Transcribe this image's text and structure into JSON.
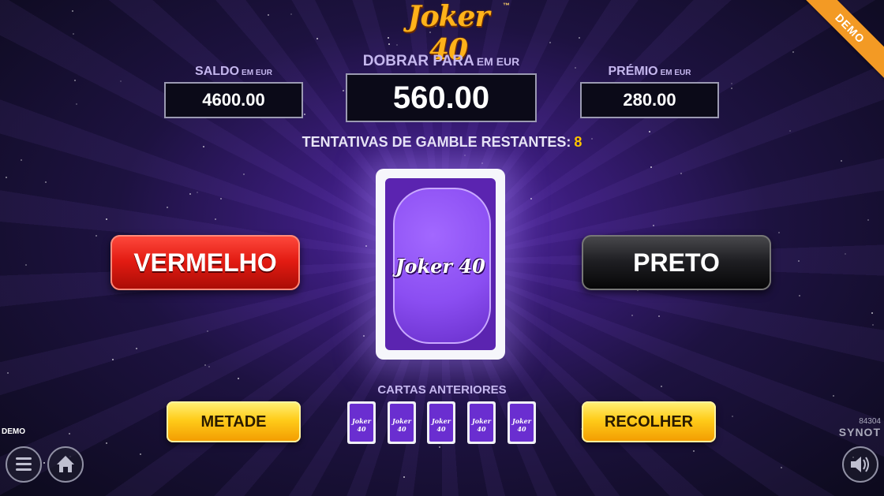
{
  "logo": {
    "text": "Joker 40",
    "tm": "™"
  },
  "demo_ribbon": "DEMO",
  "demo_label": "DEMO",
  "balance": {
    "label": "SALDO",
    "unit": "EM EUR",
    "value": "4600.00"
  },
  "double_to": {
    "label": "DOBRAR PARA",
    "unit": "EM EUR",
    "value": "560.00"
  },
  "prize": {
    "label": "PRÉMIO",
    "unit": "EM EUR",
    "value": "280.00"
  },
  "gamble_attempts": {
    "label": "TENTATIVAS DE GAMBLE RESTANTES:",
    "value": "8"
  },
  "buttons": {
    "red": "VERMELHO",
    "black": "PRETO",
    "half": "METADE",
    "collect": "RECOLHER"
  },
  "card_logo": "Joker 40",
  "previous_cards": {
    "label": "CARTAS ANTERIORES",
    "cards": [
      "Joker 40",
      "Joker 40",
      "Joker 40",
      "Joker 40",
      "Joker 40"
    ]
  },
  "game_id": "84304",
  "brand": "SYNOT",
  "icons": {
    "menu": "menu-icon",
    "home": "home-icon",
    "sound": "speaker-icon"
  },
  "colors": {
    "accent_yellow": "#ffc400",
    "red_button": "#e21b12",
    "ribbon": "#f39a24"
  }
}
